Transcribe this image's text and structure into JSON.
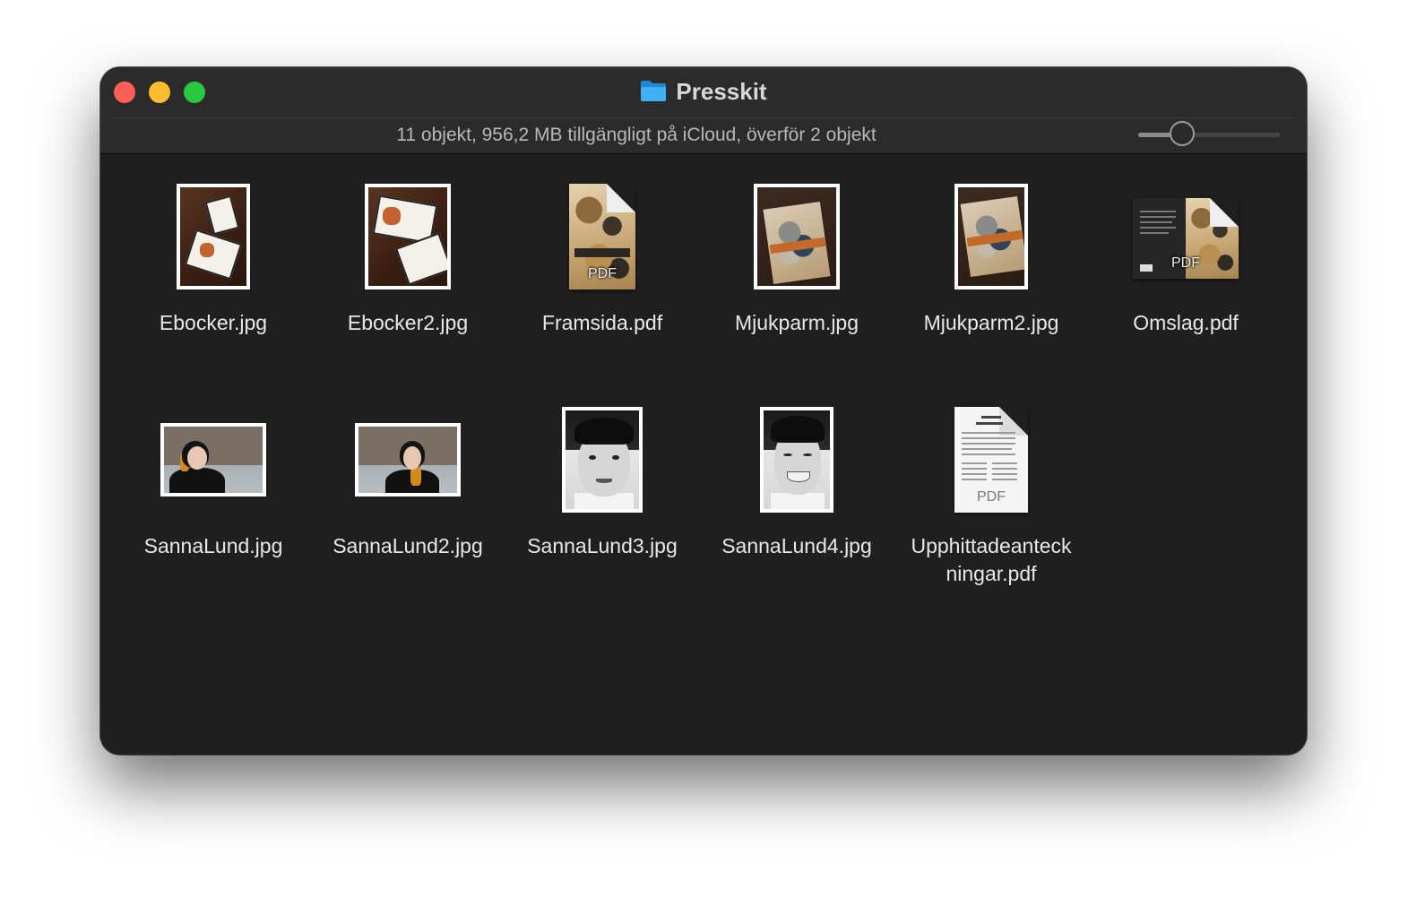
{
  "window": {
    "title": "Presskit",
    "title_icon": "folder-icon",
    "status": "11 objekt, 956,2 MB tillgängligt på iCloud, överför 2 objekt",
    "icon_size_slider": {
      "value": 0.27
    },
    "colors": {
      "close": "#ff5f57",
      "minimize": "#febc2e",
      "maximize": "#28c840",
      "folder": "#2fa5f0"
    }
  },
  "files": [
    {
      "name": "Ebocker.jpg",
      "kind": "jpg"
    },
    {
      "name": "Ebocker2.jpg",
      "kind": "jpg"
    },
    {
      "name": "Framsida.pdf",
      "kind": "pdf",
      "badge": "PDF"
    },
    {
      "name": "Mjukparm.jpg",
      "kind": "jpg"
    },
    {
      "name": "Mjukparm2.jpg",
      "kind": "jpg"
    },
    {
      "name": "Omslag.pdf",
      "kind": "pdf",
      "badge": "PDF"
    },
    {
      "name": "SannaLund.jpg",
      "kind": "jpg"
    },
    {
      "name": "SannaLund2.jpg",
      "kind": "jpg"
    },
    {
      "name": "SannaLund3.jpg",
      "kind": "jpg"
    },
    {
      "name": "SannaLund4.jpg",
      "kind": "jpg"
    },
    {
      "name": "Upphittadeanteck ningar.pdf",
      "kind": "pdf",
      "badge": "PDF"
    }
  ]
}
